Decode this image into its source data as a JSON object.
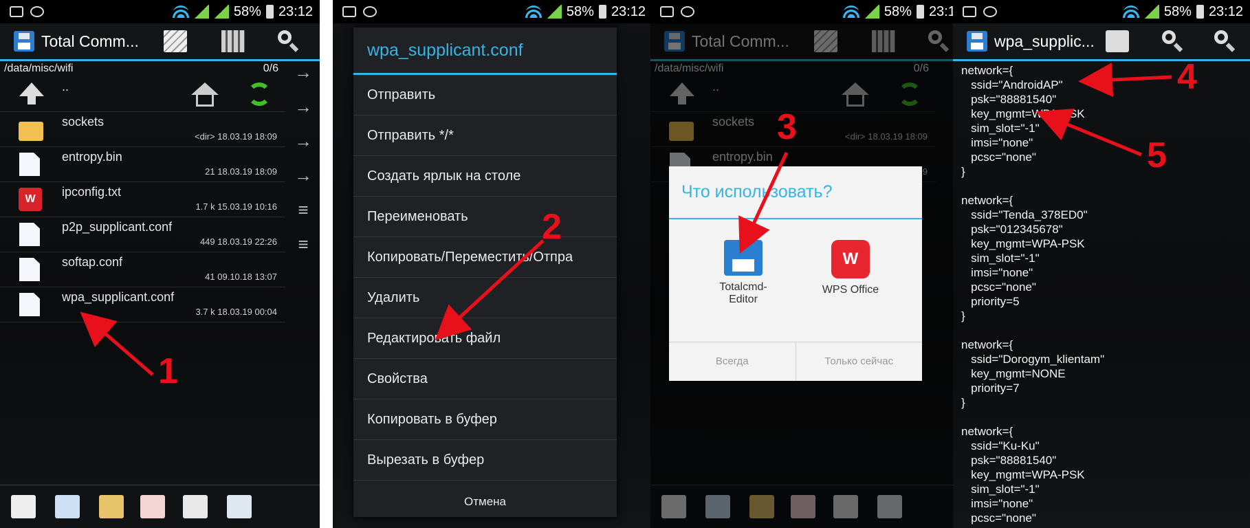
{
  "status": {
    "battery": "58%",
    "time": "23:12"
  },
  "panel1": {
    "app_title": "Total Comm...",
    "path": "/data/misc/wifi",
    "count": "0/6",
    "up_label": "..",
    "files": [
      {
        "name": "sockets",
        "meta": "<dir> 18.03.19 18:09",
        "type": "folder"
      },
      {
        "name": "entropy.bin",
        "meta": "21 18.03.19 18:09",
        "type": "file"
      },
      {
        "name": "ipconfig.txt",
        "meta": "1.7 k 15.03.19 10:16",
        "type": "wps"
      },
      {
        "name": "p2p_supplicant.conf",
        "meta": "449 18.03.19 22:26",
        "type": "file"
      },
      {
        "name": "softap.conf",
        "meta": "41 09.10.18 13:07",
        "type": "file"
      },
      {
        "name": "wpa_supplicant.conf",
        "meta": "3.7 k 18.03.19 00:04",
        "type": "file"
      }
    ]
  },
  "panel2": {
    "dialog_title": "wpa_supplicant.conf",
    "items": [
      "Отправить",
      "Отправить */*",
      "Создать ярлык на столе",
      "Переименовать",
      "Копировать/Переместить/Отпра",
      "Удалить",
      "Редактировать файл",
      "Свойства",
      "Копировать в буфер",
      "Вырезать в буфер"
    ],
    "cancel": "Отмена"
  },
  "panel3": {
    "chooser_title": "Что использовать?",
    "app1_line1": "Totalcmd-",
    "app1_line2": "Editor",
    "app2": "WPS Office",
    "btn_always": "Всегда",
    "btn_once": "Только сейчас"
  },
  "panel4": {
    "app_title": "wpa_supplic...",
    "text": "network={\n   ssid=\"AndroidAP\"\n   psk=\"88881540\"\n   key_mgmt=WPA-PSK\n   sim_slot=\"-1\"\n   imsi=\"none\"\n   pcsc=\"none\"\n}\n\nnetwork={\n   ssid=\"Tenda_378ED0\"\n   psk=\"012345678\"\n   key_mgmt=WPA-PSK\n   sim_slot=\"-1\"\n   imsi=\"none\"\n   pcsc=\"none\"\n   priority=5\n}\n\nnetwork={\n   ssid=\"Dorogym_klientam\"\n   key_mgmt=NONE\n   priority=7\n}\n\nnetwork={\n   ssid=\"Ku-Ku\"\n   psk=\"88881540\"\n   key_mgmt=WPA-PSK\n   sim_slot=\"-1\"\n   imsi=\"none\"\n   pcsc=\"none\"\n}"
  },
  "annotations": [
    "1",
    "2",
    "3",
    "4",
    "5"
  ],
  "colors": {
    "accent": "#33b5e5",
    "annotation": "#e8101a"
  }
}
